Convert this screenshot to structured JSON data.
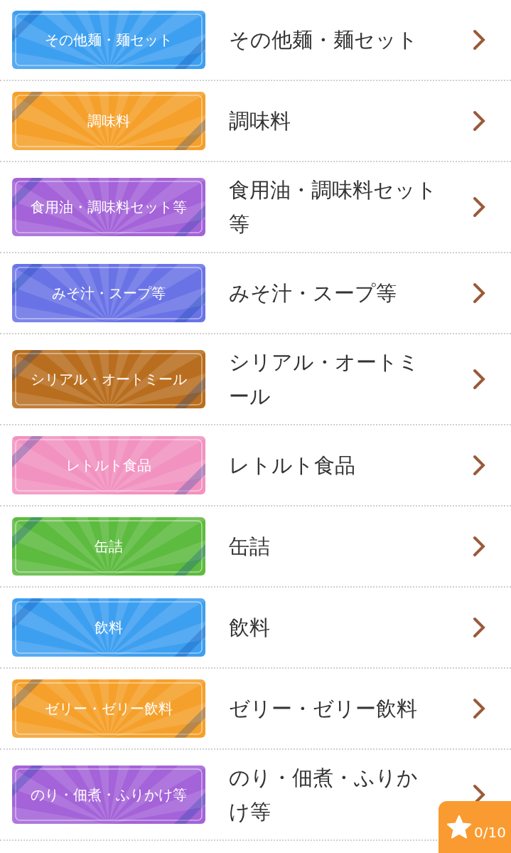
{
  "categories": [
    {
      "banner": "その他麺・麺セット",
      "title": "その他麺・麺セット",
      "color": "#3d9ff0"
    },
    {
      "banner": "調味料",
      "title": "調味料",
      "color": "#f5a02a"
    },
    {
      "banner": "食用油・調味料セット等",
      "title": "食用油・調味料セット等",
      "color": "#a463d8"
    },
    {
      "banner": "みそ汁・スープ等",
      "title": "みそ汁・スープ等",
      "color": "#6a73e6"
    },
    {
      "banner": "シリアル・オートミール",
      "title": "シリアル・オートミール",
      "color": "#b86e1e"
    },
    {
      "banner": "レトルト食品",
      "title": "レトルト食品",
      "color": "#f292c0"
    },
    {
      "banner": "缶詰",
      "title": "缶詰",
      "color": "#5dbb3f"
    },
    {
      "banner": "飲料",
      "title": "飲料",
      "color": "#3d9ff0"
    },
    {
      "banner": "ゼリー・ゼリー飲料",
      "title": "ゼリー・ゼリー飲料",
      "color": "#f5a02a"
    },
    {
      "banner": "のり・佃煮・ふりかけ等",
      "title": "のり・佃煮・ふりかけ等",
      "color": "#a463d8"
    }
  ],
  "favorites_badge": {
    "count": "0/10"
  }
}
